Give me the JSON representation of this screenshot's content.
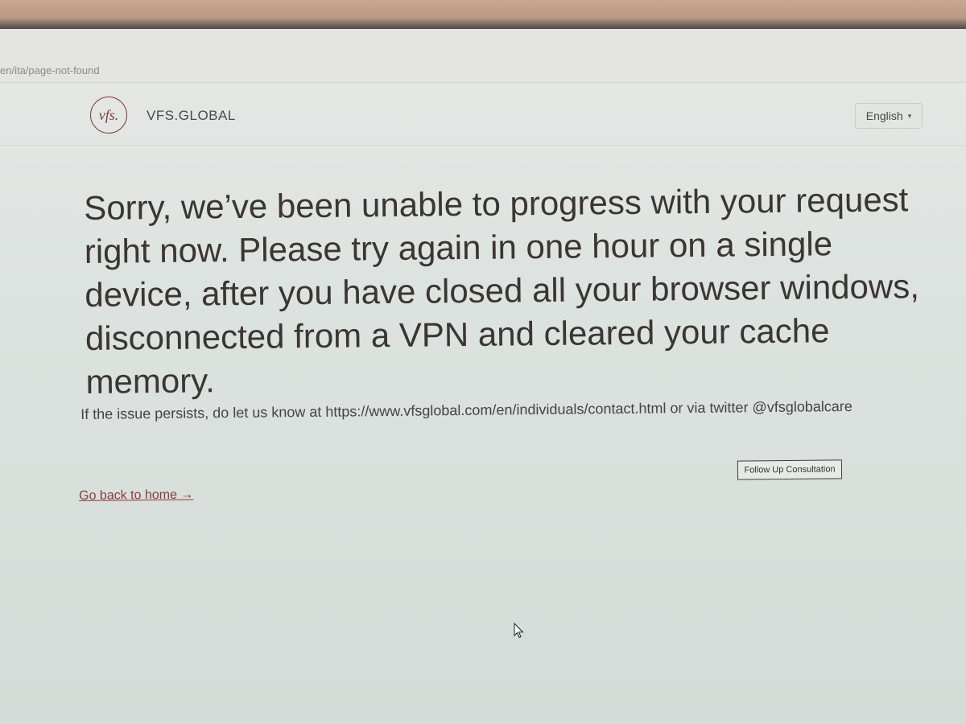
{
  "browser": {
    "url": "en/ita/page-not-found"
  },
  "header": {
    "logo_mark": "vfs.",
    "logo_text": "VFS.GLOBAL",
    "language_label": "English",
    "language_caret": "▾"
  },
  "main": {
    "headline": "Sorry, we’ve been unable to progress with your request right now. Please try again in one hour on a single device, after you have closed all your browser windows, disconnected from a VPN and cleared your cache memory.",
    "info": "If the issue persists, do let us know at https://www.vfsglobal.com/en/individuals/contact.html or via twitter @vfsglobalcare",
    "follow_up_label": "Follow Up Consultation",
    "home_link_label": "Go back to home →"
  },
  "colors": {
    "brand_maroon": "#7a3d3d",
    "link": "#8e3a3a",
    "text": "#3b3535"
  }
}
